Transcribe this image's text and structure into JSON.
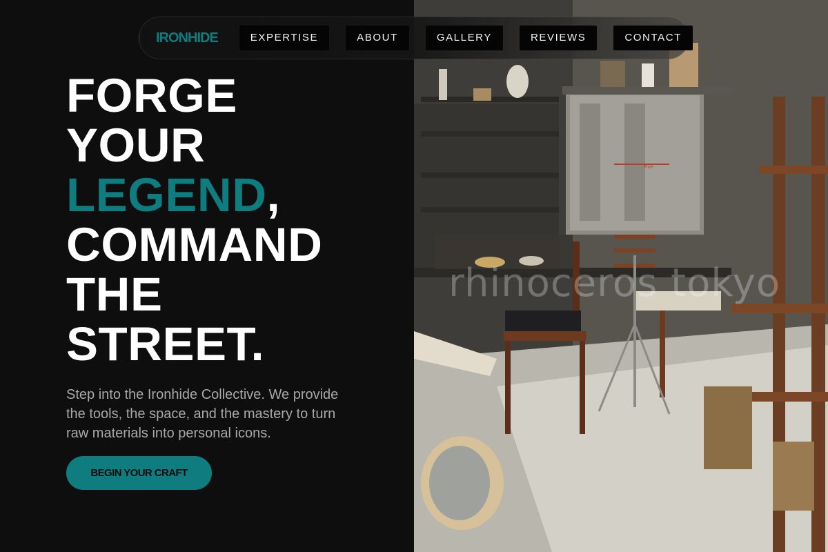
{
  "nav": {
    "brand": "IRONHIDE",
    "links": [
      "EXPERTISE",
      "ABOUT",
      "GALLERY",
      "REVIEWS",
      "CONTACT"
    ]
  },
  "hero": {
    "headline": {
      "line1": "FORGE",
      "line2": "YOUR",
      "line3_accent": "LEGEND",
      "line3_punct": ",",
      "line4": "COMMAND",
      "line5": "THE",
      "line6": "STREET."
    },
    "lead": "Step into the Ironhide Collective. We provide the tools, the space, and the mastery to turn raw materials into personal icons.",
    "cta_label": "BEGIN YOUR CRAFT"
  },
  "photo": {
    "watermark": "rhinoceros tokyo",
    "kiln_label": "Five",
    "subject": "workshop-photo"
  },
  "colors": {
    "accent": "#0f7d80",
    "background": "#0e0e0e",
    "text": "#ffffff",
    "muted_text": "#a8a8a8"
  }
}
